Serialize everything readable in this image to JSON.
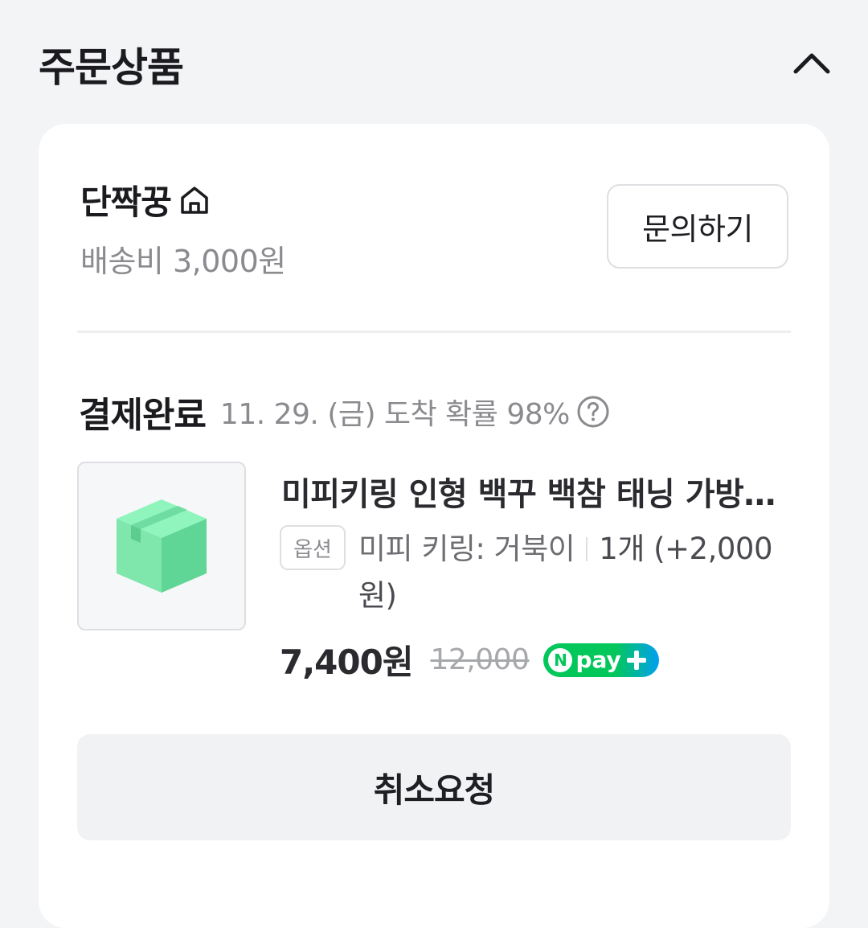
{
  "section": {
    "title": "주문상품",
    "collapse_icon": "chevron-up-icon"
  },
  "seller": {
    "name": "단짝꿍",
    "home_icon": "home-icon",
    "shipping_fee": "배송비 3,000원",
    "inquiry_label": "문의하기"
  },
  "order": {
    "status": "결제완료",
    "arrival": "11. 29. (금) 도착 확률 98%",
    "help_icon": "question-circle-icon"
  },
  "product": {
    "thumbnail_icon": "box-icon",
    "title": "미피키링 인형 백꾸 백참 태닝 가방고리",
    "option_badge": "옵션",
    "option_name": "미피 키링: 거북이",
    "option_qty": "1개 (+2,000원)",
    "sale_price": "7,400원",
    "original_price": "12,000",
    "npay_badge": {
      "n": "N",
      "label": "pay",
      "colors": [
        "#03c75a",
        "#00a0f0"
      ]
    }
  },
  "actions": {
    "cancel_label": "취소요청"
  }
}
